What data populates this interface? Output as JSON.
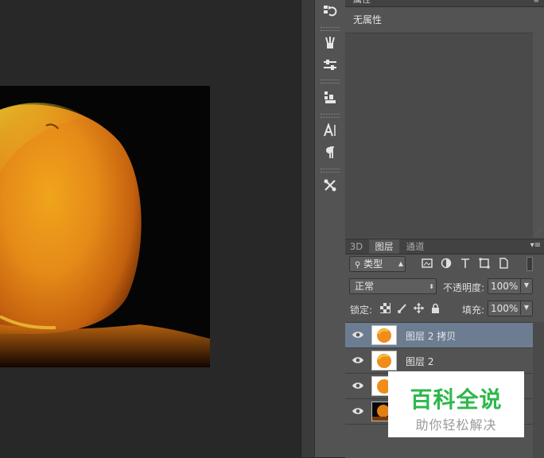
{
  "properties_panel": {
    "title": "属性",
    "no_properties_text": "无属性"
  },
  "layers_panel": {
    "tabs": [
      {
        "label": "3D",
        "active": false
      },
      {
        "label": "图层",
        "active": true
      },
      {
        "label": "通道",
        "active": false
      }
    ],
    "filter_kind": "类型",
    "blend_mode": "正常",
    "opacity_label": "不透明度:",
    "opacity_value": "100%",
    "lock_label": "锁定:",
    "fill_label": "填充:",
    "fill_value": "100%",
    "layers": [
      {
        "name": "图层 2 拷贝",
        "selected": true
      },
      {
        "name": "图层 2",
        "selected": false
      },
      {
        "name": "",
        "selected": false
      },
      {
        "name": "",
        "selected": false
      }
    ]
  },
  "tool_strip_icons": [
    "history-icon",
    "brush-preset-icon",
    "adjustments-icon",
    "clone-source-icon",
    "character-icon",
    "paragraph-icon",
    "tool-presets-icon"
  ],
  "watermark": {
    "title": "百科全说",
    "subtitle": "助你轻松解决",
    "title_color": "#2db84b"
  },
  "colors": {
    "selected_layer": "#6d7d91",
    "panel": "#535353",
    "canvas_bg": "#282828"
  }
}
